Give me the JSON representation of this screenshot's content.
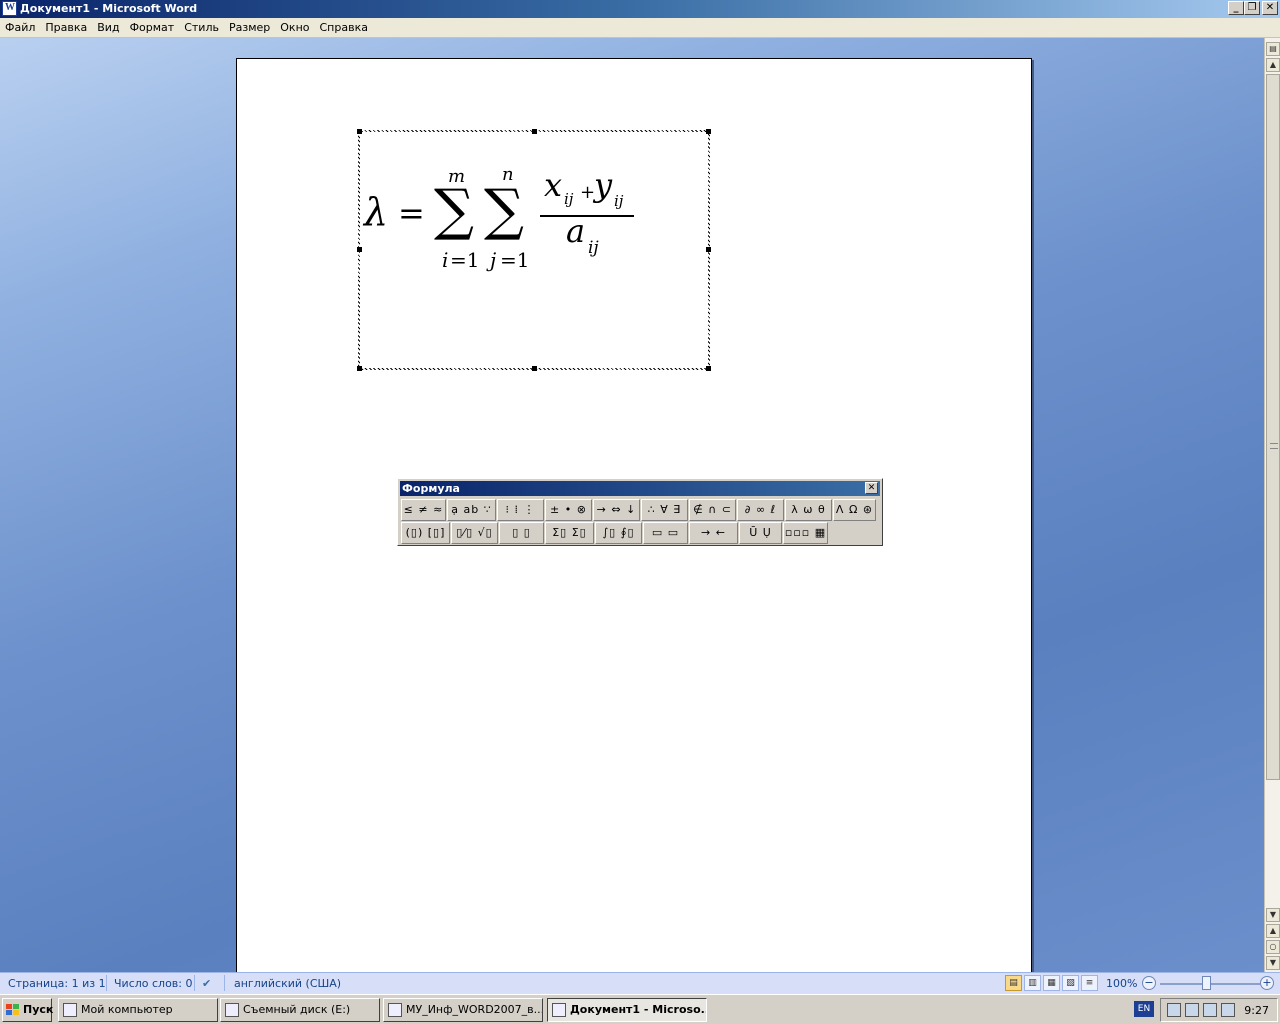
{
  "window": {
    "title": "Документ1 - Microsoft Word",
    "icon_letter": "W",
    "controls": [
      "_",
      "❐",
      "✕"
    ]
  },
  "menu": [
    "Файл",
    "Правка",
    "Вид",
    "Формат",
    "Стиль",
    "Размер",
    "Окно",
    "Справка"
  ],
  "equation": {
    "lhs": "λ",
    "eq": "=",
    "sigma": "∑",
    "sum1_upper": "m",
    "sum1_lower_var": "i",
    "sum1_lower_rest": "=1",
    "sum2_upper": "n",
    "sum2_lower_var": "j",
    "sum2_lower_rest": "=1",
    "num_x": "x",
    "num_x_sub": "ij",
    "num_plus": "+",
    "num_y": "y",
    "num_y_sub": "ij",
    "den_a": "a",
    "den_a_sub": "ij"
  },
  "toolbar": {
    "title": "Формула",
    "close": "✕",
    "row1": [
      "≤ ≠ ≈",
      "ạ ab ∵",
      "⁝ ⁞ ⋮",
      "± • ⊗",
      "→ ⇔ ↓",
      "∴ ∀ ∃",
      "∉ ∩ ⊂",
      "∂ ∞ ℓ",
      "λ ω θ",
      "Λ Ω ⊛"
    ],
    "row2": [
      "(▯) [▯]",
      "▯⁄▯ √▯",
      "▯ ▯",
      "Σ▯ Σ▯",
      "∫▯ ∮▯",
      "▭ ▭",
      "→ ←",
      "Ū Ụ",
      "▫▫▫ ▦"
    ]
  },
  "status": {
    "page": "Страница: 1 из 1",
    "words": "Число слов: 0",
    "language": "английский (США)",
    "zoom": "100%",
    "zoom_minus": "−",
    "zoom_plus": "+",
    "view_icons": [
      "▤",
      "▥",
      "▦",
      "▧",
      "≡"
    ]
  },
  "scrollbar": {
    "up": "▲",
    "down": "▼",
    "browse_prev": "▲",
    "browse_select": "○",
    "browse_next": "▼"
  },
  "taskbar": {
    "start": "Пуск",
    "tasks": [
      "Мой компьютер",
      "Съемный диск (E:)",
      "МУ_Инф_WORD2007_в...",
      "Документ1 - Microso..."
    ],
    "lang": "EN",
    "time": "9:27"
  }
}
